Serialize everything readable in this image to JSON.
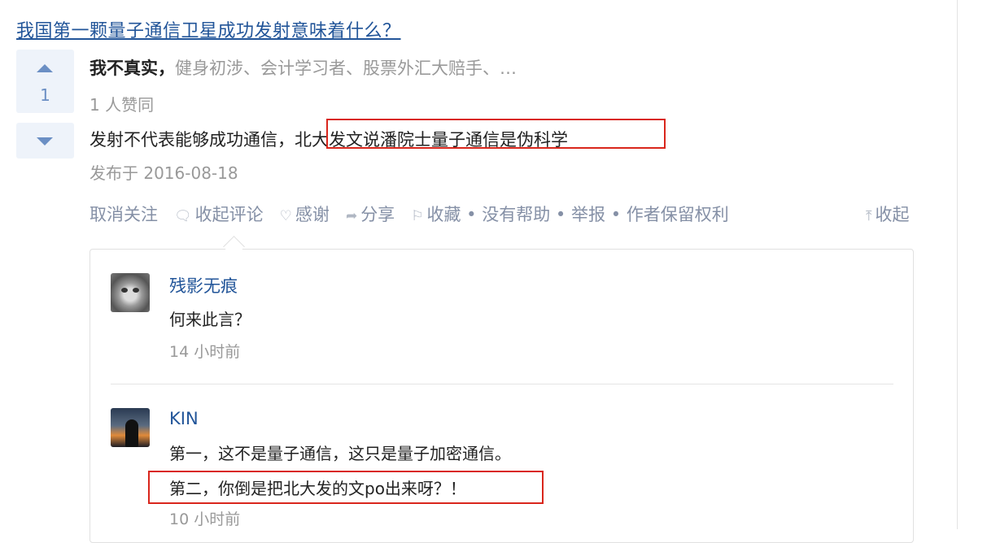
{
  "question": {
    "title": "我国第一颗量子通信卫星成功发射意味着什么？"
  },
  "vote": {
    "up_count": "1"
  },
  "answer": {
    "author_name": "我不真实",
    "author_sep": "，",
    "author_bio": "健身初涉、会计学习者、股票外汇大赔手、…",
    "votes_text": "1 人赞同",
    "text_before": "发射不代表能够成功通信，",
    "text_highlight": "北大发文说潘院士量子通信是伪科学",
    "date": "发布于 2016-08-18"
  },
  "actions": {
    "unfollow": "取消关注",
    "collapse_comments": "收起评论",
    "thanks": "感谢",
    "share": "分享",
    "favorite": "收藏",
    "dot": "•",
    "not_helpful": "没有帮助",
    "report": "举报",
    "copyright": "作者保留权利",
    "collapse": "收起"
  },
  "comments": [
    {
      "name": "残影无痕",
      "lines": [
        "何来此言？"
      ],
      "time": "14 小时前",
      "avatar": "cat-avatar"
    },
    {
      "name": "KIN",
      "lines": [
        "第一，这不是量子通信，这只是量子加密通信。",
        "第二，你倒是把北大发的文po出来呀？！"
      ],
      "time": "10 小时前",
      "avatar": "sunset-avatar"
    }
  ],
  "colors": {
    "link": "#225599",
    "highlight_box": "#d9261c",
    "vote_bg": "#eef3fa",
    "muted": "#999999"
  }
}
